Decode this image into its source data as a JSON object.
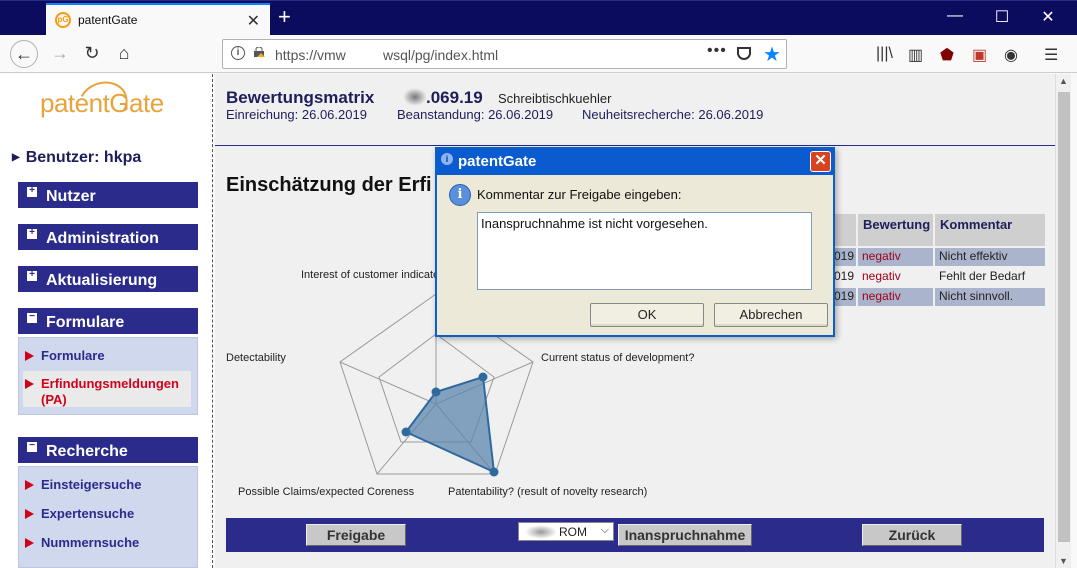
{
  "browser": {
    "tab_title": "patentGate",
    "url_prefix": "https://vmw",
    "url_suffix": "wsql/pg/index.html"
  },
  "sidebar": {
    "logo_text": "patentGate",
    "user_label": "Benutzer: hkpa",
    "sections": {
      "nutzer": "Nutzer",
      "administration": "Administration",
      "aktualisierung": "Aktualisierung",
      "formulare": "Formulare",
      "recherche": "Recherche"
    },
    "formulare_items": [
      "Formulare",
      "Erfindungsmeldungen",
      "(PA)"
    ],
    "recherche_items": [
      "Einsteigersuche",
      "Expertensuche",
      "Nummernsuche"
    ]
  },
  "header": {
    "title": "Bewertungsmatrix",
    "number": ".069.19",
    "name": "Schreibtischkuehler",
    "einreichung": "Einreichung: 26.06.2019",
    "beanstandung": "Beanstandung: 26.06.2019",
    "neuheitsrecherche": "Neuheitsrecherche: 26.06.2019"
  },
  "page_heading": "Einschätzung der Erfi",
  "table": {
    "col_bewertung": "Bewertung",
    "col_kommentar": "Kommentar",
    "rows": [
      {
        "year": "019",
        "bewertung": "negativ",
        "kommentar": "Nicht effektiv"
      },
      {
        "year": "019",
        "bewertung": "negativ",
        "kommentar": "Fehlt der Bedarf"
      },
      {
        "year": "019",
        "bewertung": "negativ",
        "kommentar": "Nicht sinnvoll."
      }
    ]
  },
  "radar": {
    "labels": {
      "top": "Interest of customer indicate",
      "right": "Current status of development?",
      "bottom_right": "Patentability? (result of novelty research)",
      "bottom_left": "Possible Claims/expected Coreness",
      "left": "Detectability"
    },
    "fill_color": "#5d87ad",
    "stroke_color": "#2e6a9e"
  },
  "buttons": {
    "freigabe": "Freigabe",
    "select_value": "ROM",
    "inanspruchnahme": "Inanspruchnahme",
    "zurueck": "Zurück"
  },
  "dialog": {
    "title": "patentGate",
    "prompt": "Kommentar zur Freigabe eingeben:",
    "input_value": "Inanspruchnahme ist nicht vorgesehen.",
    "ok": "OK",
    "cancel": "Abbrechen"
  }
}
